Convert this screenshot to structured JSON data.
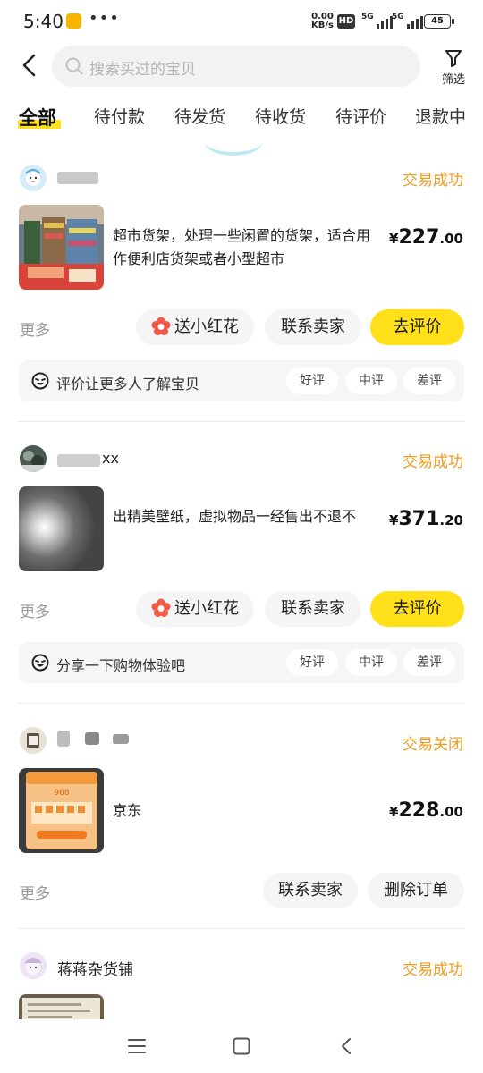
{
  "status_bar": {
    "time": "5:40",
    "dots": "•••",
    "net_speed_value": "0.00",
    "net_speed_unit": "KB/s",
    "hd": "HD",
    "signal1": "5G",
    "signal2": "5G",
    "battery": "45"
  },
  "topbar": {
    "search_placeholder": "搜索买过的宝贝",
    "filter_label": "筛选"
  },
  "tabs": [
    {
      "label": "全部",
      "active": true
    },
    {
      "label": "待付款"
    },
    {
      "label": "待发货"
    },
    {
      "label": "待收货"
    },
    {
      "label": "待评价"
    },
    {
      "label": "退款中"
    }
  ],
  "orders": [
    {
      "status": "交易成功",
      "title": "超市货架，处理一些闲置的货架，适合用作便利店货架或者小型超市",
      "price_symbol": "¥",
      "price_int": "227",
      "price_dec": ".00",
      "more": "更多",
      "btn_flower": "送小红花",
      "btn_contact": "联系卖家",
      "btn_review": "去评价",
      "review_prompt": "评价让更多人了解宝贝",
      "rv_good": "好评",
      "rv_mid": "中评",
      "rv_bad": "差评"
    },
    {
      "seller": "xx",
      "status": "交易成功",
      "title": "出精美壁纸，虚拟物品一经售出不退不",
      "price_symbol": "¥",
      "price_int": "371",
      "price_dec": ".20",
      "more": "更多",
      "btn_flower": "送小红花",
      "btn_contact": "联系卖家",
      "btn_review": "去评价",
      "review_prompt": "分享一下购物体验吧",
      "rv_good": "好评",
      "rv_mid": "中评",
      "rv_bad": "差评"
    },
    {
      "status": "交易关闭",
      "title": "京东",
      "price_symbol": "¥",
      "price_int": "228",
      "price_dec": ".00",
      "more": "更多",
      "btn_contact": "联系卖家",
      "btn_delete": "删除订单"
    },
    {
      "seller": "蒋蒋杂货铺",
      "status": "交易成功"
    }
  ],
  "colors": {
    "accent_yellow": "#ffe01a",
    "status_orange": "#f09b1d"
  },
  "icons": [
    "back-icon",
    "search-icon",
    "filter-icon",
    "flower-icon",
    "face-icon",
    "menu-icon",
    "home-icon",
    "back-nav-icon"
  ]
}
